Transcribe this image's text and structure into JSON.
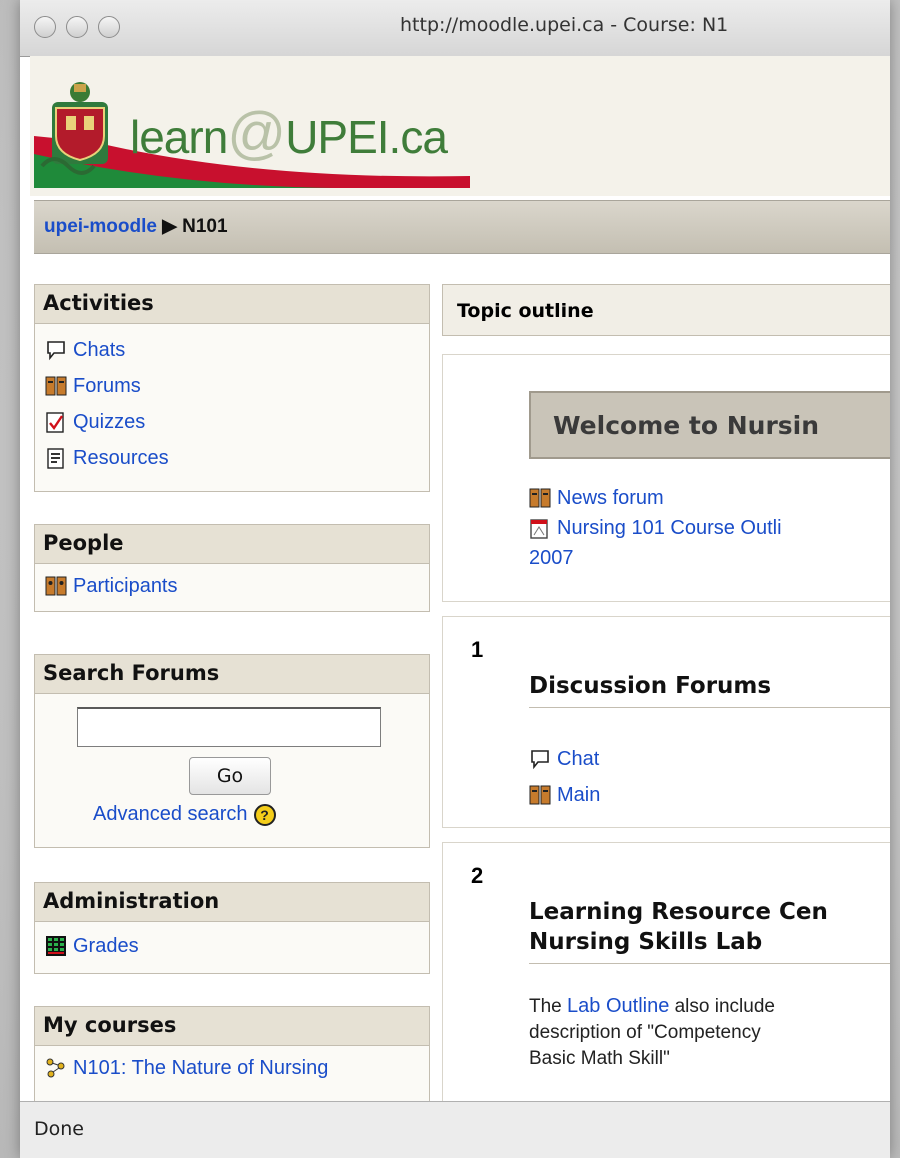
{
  "browser": {
    "url": "http://moodle.upei.ca - Course: N1",
    "status": "Done"
  },
  "header": {
    "logo_learn": "learn",
    "logo_at": "@",
    "logo_rest": "UPEI.ca"
  },
  "breadcrumb": {
    "home": "upei-moodle",
    "separator": "▶",
    "current": "N101"
  },
  "blocks": {
    "activities": {
      "title": "Activities",
      "items": [
        {
          "label": "Chats",
          "icon": "chat-icon"
        },
        {
          "label": "Forums",
          "icon": "forum-icon"
        },
        {
          "label": "Quizzes",
          "icon": "quiz-icon"
        },
        {
          "label": "Resources",
          "icon": "resource-icon"
        }
      ]
    },
    "people": {
      "title": "People",
      "items": [
        {
          "label": "Participants",
          "icon": "participants-icon"
        }
      ]
    },
    "search": {
      "title": "Search Forums",
      "input_value": "",
      "go_label": "Go",
      "advanced_label": "Advanced search",
      "help_glyph": "?"
    },
    "administration": {
      "title": "Administration",
      "items": [
        {
          "label": "Grades",
          "icon": "grades-icon"
        }
      ]
    },
    "my_courses": {
      "title": "My courses",
      "items": [
        {
          "label": "N101: The Nature of Nursing",
          "icon": "course-icon"
        }
      ]
    }
  },
  "main": {
    "outline_title": "Topic outline",
    "section0": {
      "welcome": "Welcome to Nursin",
      "links": [
        "News forum",
        "Nursing 101 Course Outli",
        "2007"
      ]
    },
    "section1": {
      "number": "1",
      "title": "Discussion Forums",
      "links": [
        "Chat",
        "Main"
      ]
    },
    "section2": {
      "number": "2",
      "title_line1": "Learning Resource Cen",
      "title_line2": "Nursing Skills Lab",
      "text_before": "The ",
      "text_link": "Lab Outline",
      "text_after1": " also include",
      "text_line2": "description of \"Competency",
      "text_line3": "Basic Math Skill\""
    }
  },
  "colors": {
    "link": "#1a4dc9",
    "block_header": "#e6e1d4",
    "logo_green": "#3f7d3a"
  }
}
